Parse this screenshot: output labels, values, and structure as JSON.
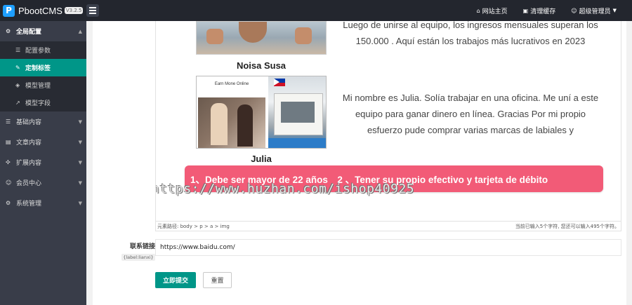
{
  "app": {
    "name": "PbootCMS",
    "version": "V3.2.5"
  },
  "topbar": {
    "links": [
      {
        "icon": "home-icon",
        "glyph": "⌂",
        "label": "网站主页"
      },
      {
        "icon": "trash-icon",
        "glyph": "🗑",
        "label": "清理缓存"
      },
      {
        "icon": "user-icon",
        "glyph": "☺",
        "label": "超级管理员"
      }
    ]
  },
  "sidebar": {
    "groups": [
      {
        "label": "全局配置",
        "open": true,
        "items": [
          {
            "label": "配置参数",
            "active": false
          },
          {
            "label": "定制标签",
            "active": true
          },
          {
            "label": "模型管理",
            "active": false
          },
          {
            "label": "模型字段",
            "active": false
          }
        ]
      },
      {
        "label": "基础内容"
      },
      {
        "label": "文章内容"
      },
      {
        "label": "扩展内容"
      },
      {
        "label": "会员中心"
      },
      {
        "label": "系统管理"
      }
    ]
  },
  "editor": {
    "caption1": "Noisa Susa",
    "text1": "Luego de unirse al equipo, los ingresos mensuales superan los 150.000 . Aquí están los trabajos más lucrativos en 2023",
    "image2_label": "Earn Mone Online",
    "caption2": "Julia",
    "text2": "Mi nombre es Julia. Solía trabajar en una oficina. Me uní a este equipo para ganar dinero en línea. Gracias Por mi propio esfuerzo pude comprar varias marcas de labiales y",
    "banner": "1、Debe ser mayor de 22 años　2 、Tener su propio efectivo y tarjeta de débito",
    "watermark": "https://www.huzhan.com/ishop40925",
    "path": "元素路径: body > p > a > img",
    "counter": "当前已输入5个字符, 您还可以输入495个字符。"
  },
  "form": {
    "link_label": "联系链接",
    "link_tag": "{label:lianxi}",
    "link_value": "https://www.baidu.com/",
    "submit_label": "立即提交",
    "reset_label": "重置"
  },
  "colors": {
    "accent": "#009688",
    "sidebar": "#393d49",
    "topbar": "#23262e",
    "banner": "#f25b77"
  }
}
